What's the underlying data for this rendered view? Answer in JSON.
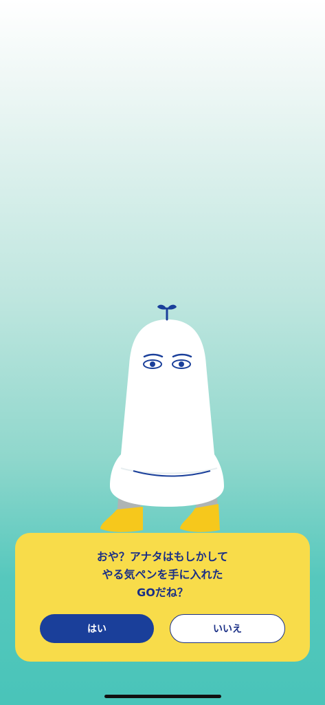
{
  "dialog": {
    "message_lines": [
      "おや？アナタはもしかして",
      "やる気ペンを手に入れた",
      "GOだね？"
    ],
    "yes_label": "はい",
    "no_label": "いいえ"
  },
  "colors": {
    "dialog_bg": "#f8dc4a",
    "primary": "#1a3f9a",
    "text": "#1a2f86",
    "background_bottom": "#49c4b9"
  }
}
